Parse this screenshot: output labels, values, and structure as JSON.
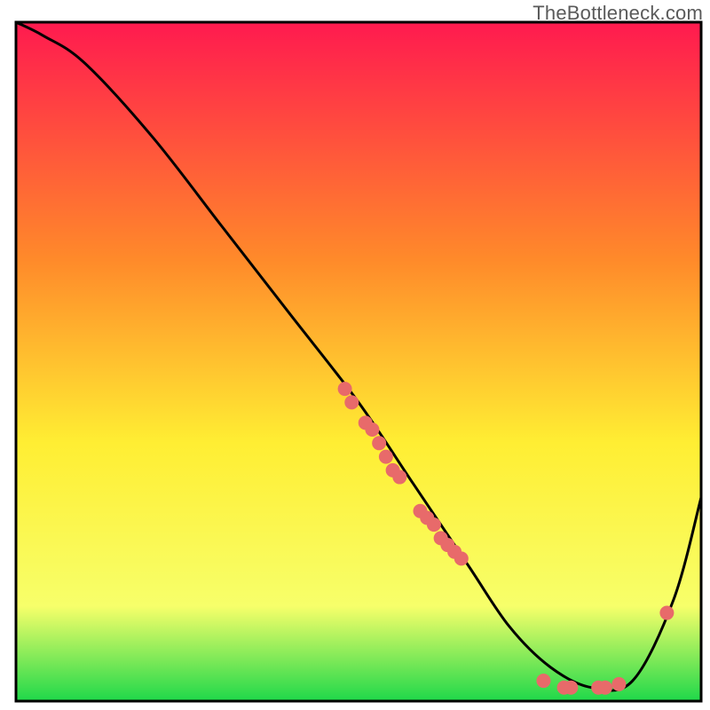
{
  "watermark": "TheBottleneck.com",
  "chart_data": {
    "type": "line",
    "title": "",
    "xlabel": "",
    "ylabel": "",
    "xlim": [
      0,
      100
    ],
    "ylim": [
      0,
      100
    ],
    "grid": false,
    "legend": false,
    "background_gradient": {
      "top": "#ff1a4f",
      "mid1": "#ff8a2a",
      "mid2": "#ffee33",
      "mid3": "#f7ff6a",
      "bottom": "#1fd84a"
    },
    "series": [
      {
        "name": "bottleneck-curve",
        "stroke": "#000000",
        "x": [
          0,
          4,
          10,
          20,
          30,
          40,
          50,
          58,
          66,
          72,
          78,
          84,
          90,
          96,
          100
        ],
        "y": [
          100,
          98,
          94,
          83,
          70,
          57,
          44,
          32,
          20,
          11,
          5,
          2,
          3,
          15,
          30
        ]
      }
    ],
    "scatter": [
      {
        "name": "highlighted-points",
        "color": "#e86a6a",
        "radius": 8,
        "points": [
          {
            "x": 48,
            "y": 46
          },
          {
            "x": 49,
            "y": 44
          },
          {
            "x": 51,
            "y": 41
          },
          {
            "x": 52,
            "y": 40
          },
          {
            "x": 53,
            "y": 38
          },
          {
            "x": 54,
            "y": 36
          },
          {
            "x": 55,
            "y": 34
          },
          {
            "x": 56,
            "y": 33
          },
          {
            "x": 59,
            "y": 28
          },
          {
            "x": 60,
            "y": 27
          },
          {
            "x": 61,
            "y": 26
          },
          {
            "x": 62,
            "y": 24
          },
          {
            "x": 63,
            "y": 23
          },
          {
            "x": 64,
            "y": 22
          },
          {
            "x": 65,
            "y": 21
          },
          {
            "x": 77,
            "y": 3
          },
          {
            "x": 80,
            "y": 2
          },
          {
            "x": 81,
            "y": 2
          },
          {
            "x": 85,
            "y": 2
          },
          {
            "x": 86,
            "y": 2
          },
          {
            "x": 88,
            "y": 2.5
          },
          {
            "x": 95,
            "y": 13
          }
        ]
      }
    ]
  }
}
